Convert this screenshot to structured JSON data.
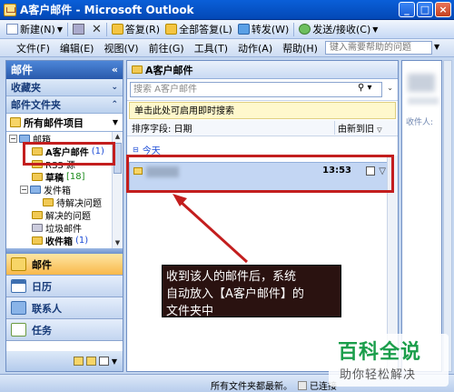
{
  "window": {
    "title": "A客户邮件 - Microsoft Outlook"
  },
  "toolbar": {
    "new_label": "新建(N)",
    "reply_label": "答复(R)",
    "reply_all_label": "全部答复(L)",
    "forward_label": "转发(W)",
    "send_receive_label": "发送/接收(C)"
  },
  "menubar": {
    "items": [
      "文件(F)",
      "编辑(E)",
      "视图(V)",
      "前往(G)",
      "工具(T)",
      "动作(A)",
      "帮助(H)"
    ],
    "help_placeholder": "键入需要帮助的问题"
  },
  "nav": {
    "title": "邮件",
    "favorites_label": "收藏夹",
    "mail_folders_label": "邮件文件夹",
    "all_items_label": "所有邮件项目",
    "tree": [
      {
        "label": "邮箱",
        "count": ""
      },
      {
        "label": "A客户邮件",
        "count": "(1)"
      },
      {
        "label": "RSS 源",
        "count": ""
      },
      {
        "label": "草稿",
        "count": "[18]"
      },
      {
        "label": "发件箱",
        "count": ""
      },
      {
        "label": "待解决问题",
        "count": ""
      },
      {
        "label": "解决的问题",
        "count": ""
      },
      {
        "label": "垃圾邮件",
        "count": ""
      },
      {
        "label": "收件箱",
        "count": "(1)"
      }
    ],
    "buttons": [
      "邮件",
      "日历",
      "联系人",
      "任务"
    ]
  },
  "list": {
    "folder_title": "A客户邮件",
    "search_placeholder": "搜索 A客户邮件",
    "instant_search_hint": "单击此处可启用即时搜索",
    "sort_label": "排序字段: 日期",
    "sort_order": "由新到旧",
    "group_label": "今天",
    "messages": [
      {
        "time": "13:53"
      }
    ]
  },
  "reading": {
    "recipient_label": "收件人:"
  },
  "status": {
    "message": "所有文件夹都最新。",
    "connection": "已连接"
  },
  "annotation": {
    "callout_lines": [
      "收到该人的邮件后，系统",
      "自动放入【A客户邮件】的",
      "文件夹中"
    ]
  },
  "watermark": {
    "title": "百科全说",
    "subtitle": "助你轻松解决"
  },
  "colors": {
    "highlight": "#c31e1e",
    "title_bar": "#0a5fd8",
    "active_nav": "#f9b84a"
  }
}
